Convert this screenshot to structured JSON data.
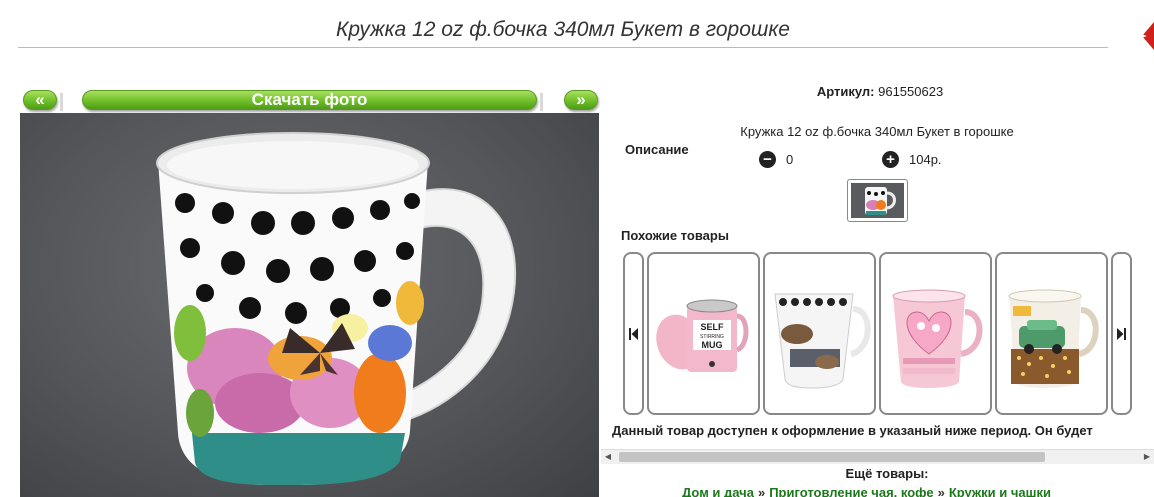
{
  "product": {
    "title": "Кружка 12 oz ф.бочка 340мл Букет в горошке",
    "sku_label": "Артикул:",
    "sku_value": "961550623",
    "description_label": "Описание",
    "description_text": "Кружка 12 oz ф.бочка 340мл Букет в горошке",
    "quantity": "0",
    "price": "104р."
  },
  "photo_nav": {
    "prev_label": "«",
    "download_label": "Скачать фото",
    "next_label": "»"
  },
  "similar": {
    "title": "Похожие товары",
    "items": [
      {
        "name": "self-stirring-mug",
        "text_lines": [
          "SELF",
          "STIRRING",
          "MUG"
        ]
      },
      {
        "name": "breakfast-mug"
      },
      {
        "name": "heart-mug"
      },
      {
        "name": "retro-car-mug"
      }
    ]
  },
  "availability_text": "Данный товар доступен к оформление в указаный ниже период. Он будет",
  "more": {
    "title": "Ещё товары:",
    "breadcrumbs": [
      "Дом и дача",
      "Приготовление чая, кофе",
      "Кружки и чашки"
    ],
    "separator": "»"
  },
  "colors": {
    "accent_green": "#6fbf2a",
    "link_green": "#1a7a1a",
    "corner_red": "#d0201c"
  }
}
